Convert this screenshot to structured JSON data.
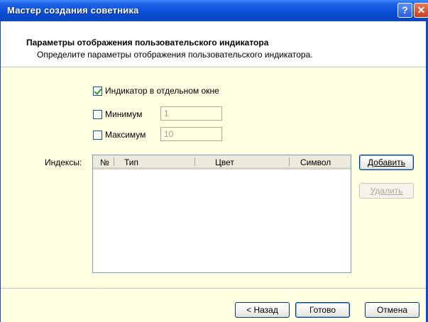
{
  "window": {
    "title": "Мастер создания советника",
    "help_icon": "?",
    "close_icon": "✕"
  },
  "header": {
    "title": "Параметры отображения пользовательского индикатора",
    "subtitle": "Определите параметры отображения пользовательского индикатора."
  },
  "options": {
    "separate_window": {
      "label": "Индикатор в отдельном окне",
      "checked": true
    },
    "minimum": {
      "label": "Минимум",
      "checked": false,
      "value": "1"
    },
    "maximum": {
      "label": "Максимум",
      "checked": false,
      "value": "10"
    }
  },
  "indexes": {
    "label": "Индексы:",
    "columns": [
      "№",
      "Тип",
      "Цвет",
      "Символ"
    ],
    "rows": []
  },
  "side_buttons": {
    "add_label": "Добавить",
    "delete_label": "Удалить"
  },
  "footer": {
    "back_label": "< Назад",
    "finish_label": "Готово",
    "cancel_label": "Отмена"
  }
}
